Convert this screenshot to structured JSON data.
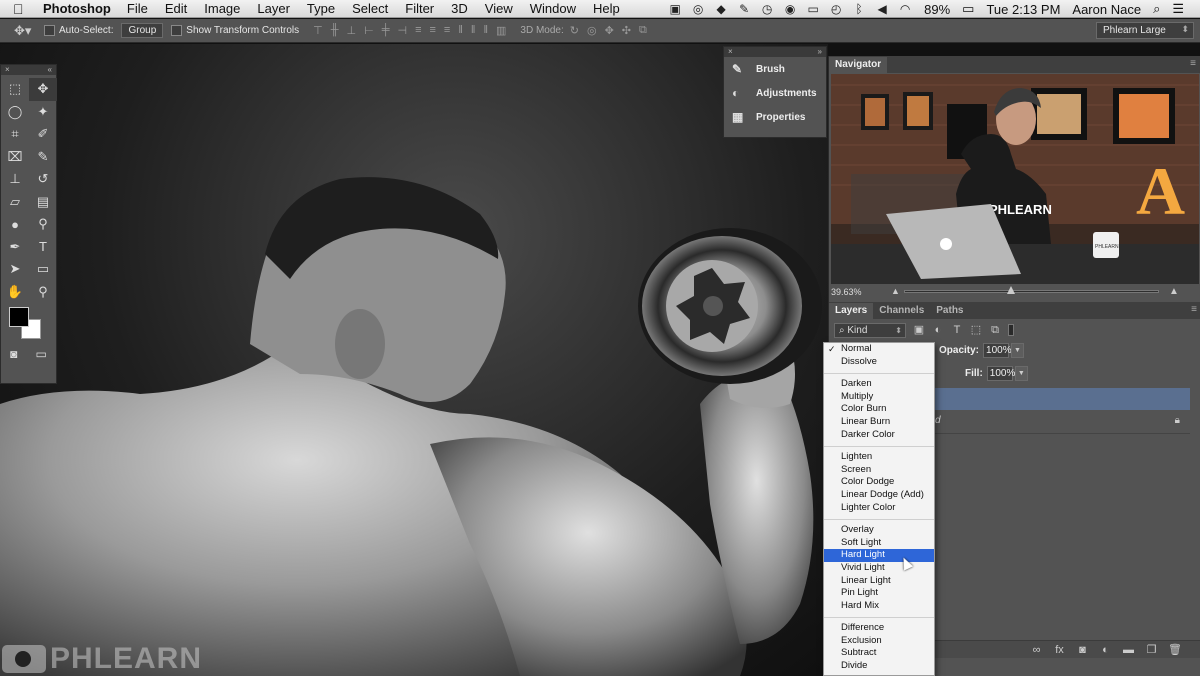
{
  "menubar": {
    "app": "Photoshop",
    "menus": [
      "File",
      "Edit",
      "Image",
      "Layer",
      "Type",
      "Select",
      "Filter",
      "3D",
      "View",
      "Window",
      "Help"
    ],
    "battery": "89%",
    "clock": "Tue 2:13 PM",
    "user": "Aaron Nace"
  },
  "options": {
    "auto_select_label": "Auto-Select:",
    "auto_select_value": "Group",
    "transform_label": "Show Transform Controls",
    "mode3d_label": "3D Mode:",
    "workspace": "Phlearn Large"
  },
  "minipanel": {
    "items": [
      {
        "label": "Brush",
        "icon": "brush-icon"
      },
      {
        "label": "Adjustments",
        "icon": "adjustments-icon"
      },
      {
        "label": "Properties",
        "icon": "properties-icon"
      }
    ]
  },
  "navigator": {
    "tab": "Navigator",
    "zoom": "39.63%",
    "slider_fraction": 0.42,
    "shirt_text": "PHLEARN",
    "mug_text": "PHLEARN"
  },
  "layers": {
    "tabs": [
      "Layers",
      "Channels",
      "Paths"
    ],
    "kind": "Kind",
    "opacity_label": "Opacity:",
    "opacity": "100%",
    "fill_label": "Fill:",
    "fill": "100%",
    "layer_name_fragment": "d"
  },
  "blend_modes": {
    "groups": [
      [
        "Normal",
        "Dissolve"
      ],
      [
        "Darken",
        "Multiply",
        "Color Burn",
        "Linear Burn",
        "Darker Color"
      ],
      [
        "Lighten",
        "Screen",
        "Color Dodge",
        "Linear Dodge (Add)",
        "Lighter Color"
      ],
      [
        "Overlay",
        "Soft Light",
        "Hard Light",
        "Vivid Light",
        "Linear Light",
        "Pin Light",
        "Hard Mix"
      ],
      [
        "Difference",
        "Exclusion",
        "Subtract",
        "Divide"
      ]
    ],
    "checked": "Normal",
    "highlighted": "Hard Light",
    "highlight_color": "#2e66d8"
  },
  "watermark": "PHLEARN",
  "colors": {
    "panel": "#535353",
    "selected_layer": "#5a6f90"
  }
}
